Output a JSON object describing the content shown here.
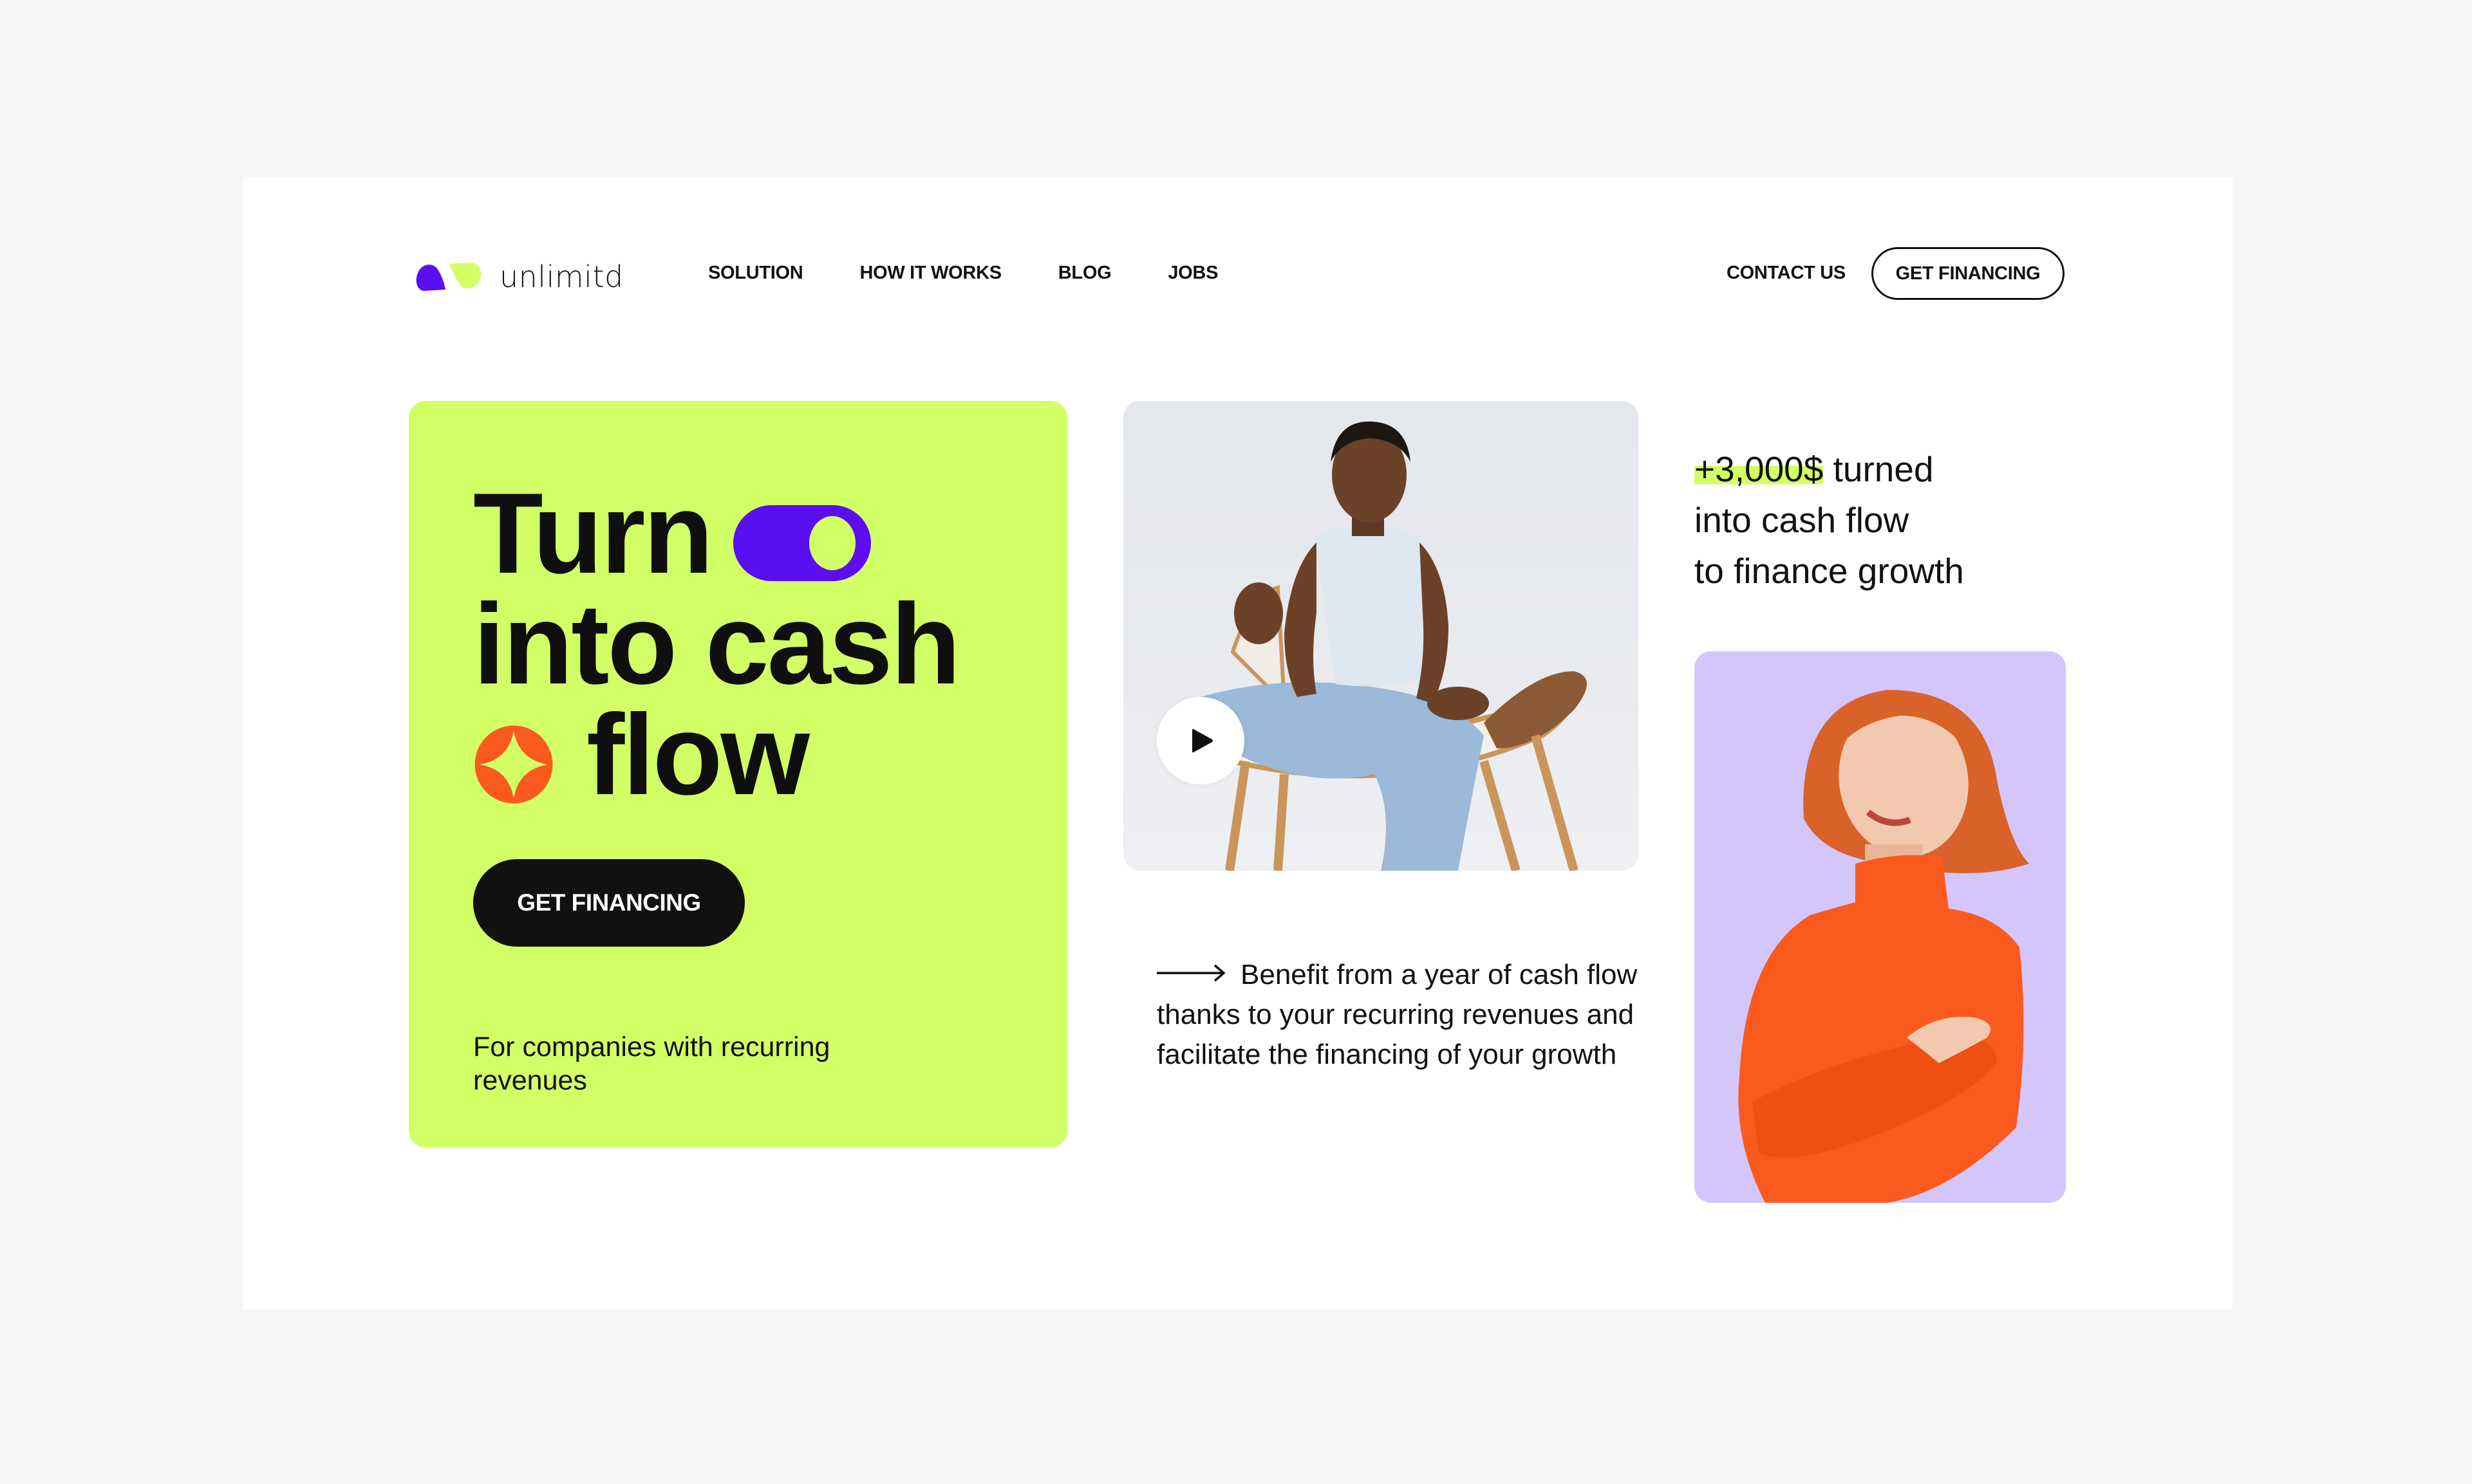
{
  "brand": {
    "name": "unlimitd",
    "logo_icon": "two-leaf-logo-icon",
    "colors": {
      "accent_green": "#d2ff66",
      "accent_purple": "#5b0ff0",
      "accent_orange": "#fb5a1e",
      "lavender": "#d4c5fb",
      "ink": "#111111"
    }
  },
  "nav": {
    "items": [
      {
        "label": "SOLUTION"
      },
      {
        "label": "HOW IT WORKS"
      },
      {
        "label": "BLOG"
      },
      {
        "label": "JOBS"
      }
    ],
    "contact_label": "CONTACT US",
    "cta_label": "GET FINANCING"
  },
  "hero": {
    "line1": "Turn",
    "line1_icon": "toggle-switch-icon",
    "line2": "into cash",
    "line3": "flow",
    "line3_icon": "sparkle-star-icon",
    "cta_label": "GET FINANCING",
    "subtitle": "For companies with recurring revenues"
  },
  "video": {
    "play_icon": "play-icon",
    "image_alt": "Woman sitting cross-legged on a wooden chair, gesturing while talking"
  },
  "benefit": {
    "arrow_icon": "long-arrow-right-icon",
    "text": "Benefit from a year of cash flow thanks to your recurring revenues and facilitate the financing of your growth"
  },
  "stat": {
    "highlight": "+3,000$",
    "rest_line1": " turned",
    "line2": "into cash flow",
    "line3": "to finance growth"
  },
  "portrait": {
    "image_alt": "Smiling red-haired woman in an orange turtleneck with arms crossed"
  }
}
